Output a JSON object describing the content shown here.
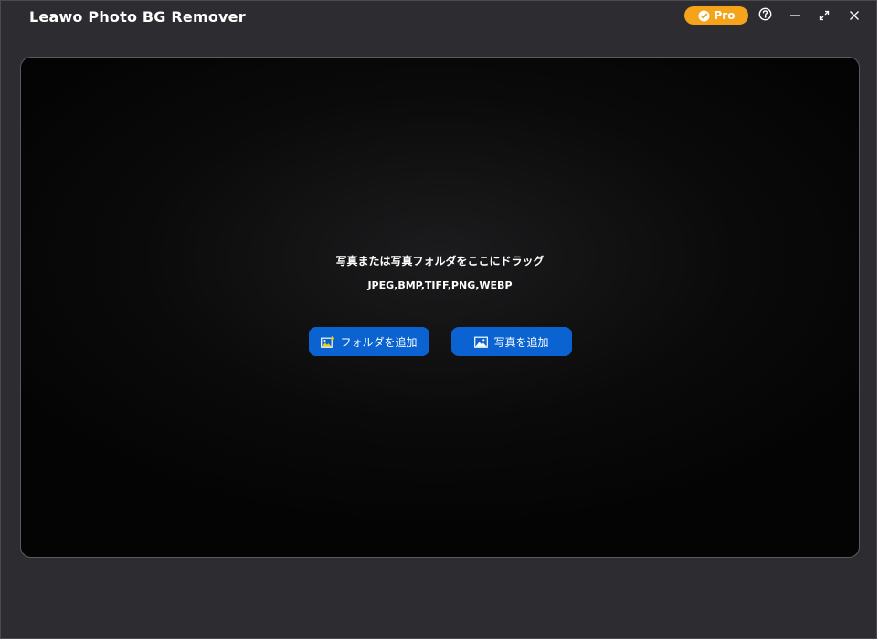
{
  "app": {
    "title": "Leawo Photo BG Remover"
  },
  "titlebar": {
    "pro_label": "Pro",
    "pro_icon": "check-badge-icon",
    "help_icon": "help-icon",
    "minimize_icon": "minimize-icon",
    "maximize_icon": "maximize-icon",
    "close_icon": "close-icon"
  },
  "drop_area": {
    "title": "写真または写真フォルダをここにドラッグ",
    "formats": "JPEG,BMP,TIFF,PNG,WEBP"
  },
  "buttons": {
    "add_folder_label": "フォルダを追加",
    "add_folder_icon": "add-image-icon",
    "add_photo_label": "写真を追加",
    "add_photo_icon": "image-icon"
  },
  "colors": {
    "pro_badge": "#f5a31a",
    "primary_button": "#0a63d1",
    "window_bg": "#2d2d31"
  }
}
